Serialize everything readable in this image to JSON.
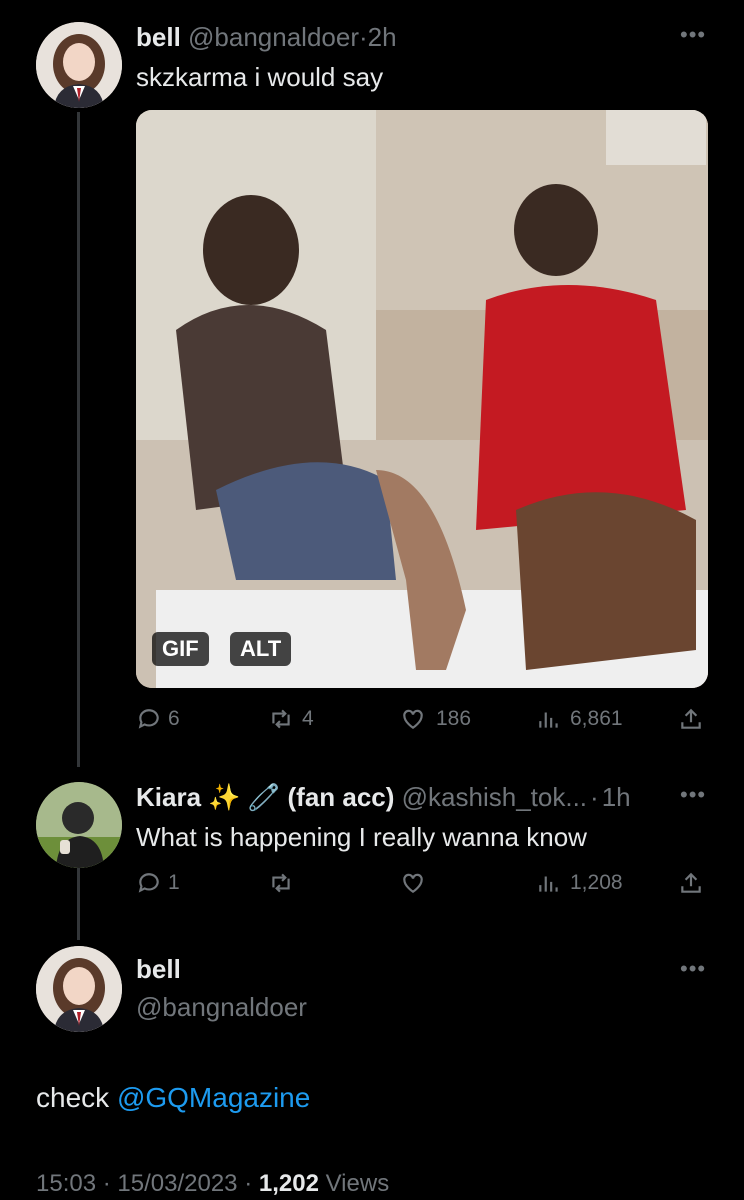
{
  "tweet1": {
    "name": "bell",
    "handle": "@bangnaldoer",
    "sep": "·",
    "time": "2h",
    "text": "skzkarma i would say",
    "media": {
      "badge_gif": "GIF",
      "badge_alt": "ALT"
    },
    "actions": {
      "replies": "6",
      "retweets": "4",
      "likes": "186",
      "views": "6,861"
    }
  },
  "tweet2": {
    "name": "Kiara",
    "name_suffix": "(fan acc)",
    "handle": "@kashish_tok...",
    "sep": "·",
    "time": "1h",
    "text": "What is happening I really wanna know",
    "actions": {
      "replies": "1",
      "views": "1,208"
    }
  },
  "tweet3": {
    "name": "bell",
    "handle": "@bangnaldoer",
    "text_prefix": "check",
    "mention": "@GQMagazine",
    "time": "15:03",
    "date": "15/03/2023",
    "views_count": "1,202",
    "views_label": "Views",
    "sep": "·"
  },
  "more_icon": "more-horizontal-icon",
  "colors": {
    "background": "#000000",
    "text": "#e7e9ea",
    "muted": "#71767b",
    "link": "#1d9bf0",
    "thread_line": "#333639"
  }
}
